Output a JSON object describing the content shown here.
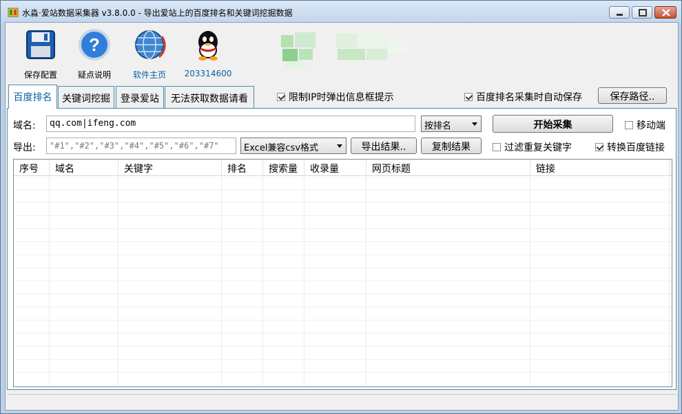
{
  "window": {
    "title": "水淼·爱站数据采集器 v3.8.0.0 - 导出爱站上的百度排名和关键词挖掘数据",
    "controls": [
      "minimize",
      "maximize",
      "close"
    ]
  },
  "toolbar": {
    "save_config": "保存配置",
    "faq": "疑点说明",
    "homepage": "软件主页",
    "qq": "203314600"
  },
  "tabs": [
    "百度排名",
    "关键词挖掘",
    "登录爱站",
    "无法获取数据请看"
  ],
  "options": {
    "limit_ip_popup": {
      "label": "限制IP时弹出信息框提示",
      "checked": true
    },
    "auto_save": {
      "label": "百度排名采集时自动保存",
      "checked": true
    },
    "save_path_button": "保存路径.."
  },
  "form": {
    "domain_label": "域名:",
    "domain_value": "qq.com|ifeng.com",
    "sort_select": "按排名",
    "start_button": "开始采集",
    "mobile": {
      "label": "移动端",
      "checked": false
    },
    "export_label": "导出:",
    "export_template": "\"#1\",\"#2\",\"#3\",\"#4\",\"#5\",\"#6\",\"#7\"",
    "format_select": "Excel兼容csv格式",
    "export_button": "导出结果..",
    "copy_button": "复制结果",
    "filter_dup": {
      "label": "过滤重复关键字",
      "checked": false
    },
    "convert_link": {
      "label": "转换百度链接",
      "checked": true
    }
  },
  "table": {
    "columns": [
      "序号",
      "域名",
      "关键字",
      "排名",
      "搜索量",
      "收录量",
      "网页标题",
      "链接"
    ],
    "rows": []
  },
  "colors": {
    "link": "#0b5fa8",
    "tab_border": "#4b8da6",
    "window_frame": "#bcd0e6"
  }
}
